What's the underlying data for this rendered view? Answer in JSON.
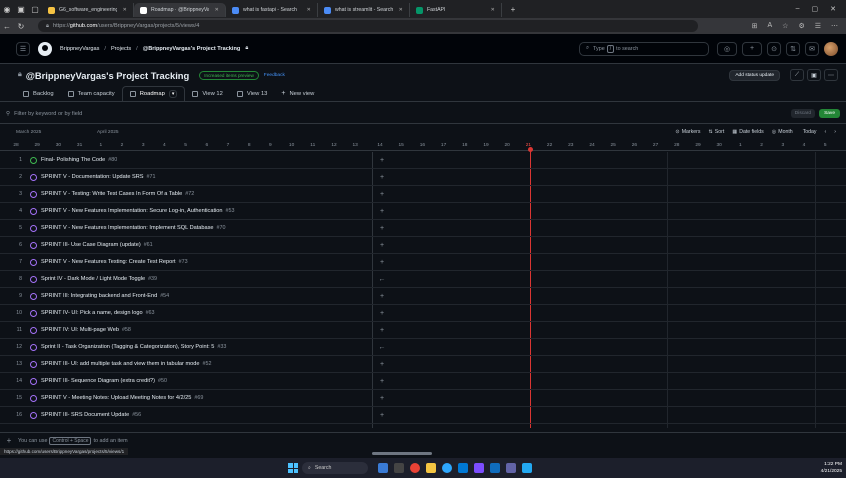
{
  "browser": {
    "tabs": [
      {
        "label": "G6_software_engineering - Goo...",
        "color": "#f6c343"
      },
      {
        "label": "Roadmap · @BrippneyVargas's Pr...",
        "color": "#ffffff",
        "active": true
      },
      {
        "label": "what is fastapi - Search",
        "color": "#4b8bf5"
      },
      {
        "label": "what is streamlit - Search",
        "color": "#4b8bf5"
      },
      {
        "label": "FastAPI",
        "color": "#059669"
      }
    ],
    "url_prefix": "https://",
    "url_host": "github.com",
    "url_path": "/users/BrippneyVargas/projects/5/views/4",
    "status_url": "https://github.com/users/BrippneyVargas/projects/5/views/1"
  },
  "header": {
    "crumb_user": "BrippneyVargas",
    "crumb_sep": "/",
    "crumb_projects": "Projects",
    "crumb_project": "@BrippneyVargas's Project Tracking",
    "search_prefix": "Type",
    "search_key": "/",
    "search_suffix": "to search"
  },
  "project": {
    "title": "@BrippneyVargas's Project Tracking",
    "badge": "Increased items preview",
    "feedback": "Feedback",
    "status_button": "Add status update"
  },
  "views": [
    {
      "label": "Backlog"
    },
    {
      "label": "Team capacity"
    },
    {
      "label": "Roadmap",
      "active": true
    },
    {
      "label": "View 12"
    },
    {
      "label": "View 13"
    },
    {
      "label": "New view"
    }
  ],
  "filter": {
    "placeholder": "Filter by keyword or by field",
    "discard": "Discard",
    "save": "Save"
  },
  "roadmap": {
    "month_left": "March 2025",
    "month_right": "April 2025",
    "tools": [
      "Markers",
      "Sort",
      "Date fields",
      "Month",
      "Today"
    ],
    "days": [
      "28",
      "29",
      "30",
      "31",
      "1",
      "2",
      "3",
      "4",
      "5",
      "6",
      "7",
      "8",
      "9",
      "10",
      "11",
      "12",
      "13",
      "14",
      "15",
      "16",
      "17",
      "18",
      "19",
      "20",
      "21",
      "22",
      "23",
      "24",
      "25",
      "26",
      "27",
      "28",
      "29",
      "30",
      "1",
      "2",
      "3",
      "4",
      "5"
    ],
    "today": "21"
  },
  "items": [
    {
      "num": "1",
      "title": "Final- Polishing The Code",
      "id": "#80",
      "open": true
    },
    {
      "num": "2",
      "title": "SPRINT V - Documentation: Update SRS",
      "id": "#71"
    },
    {
      "num": "3",
      "title": "SPRINT V - Testing: Write Test Cases In Form Of a Table",
      "id": "#72"
    },
    {
      "num": "4",
      "title": "SPRINT V - New Features Implementation: Secure Log-in, Authentication",
      "id": "#53"
    },
    {
      "num": "5",
      "title": "SPRINT V - New Features Implementation: Implement SQL Database",
      "id": "#70"
    },
    {
      "num": "6",
      "title": "SPRINT III- Use Case Diagram (update)",
      "id": "#61"
    },
    {
      "num": "7",
      "title": "SPRINT V - New Features Testing: Create Test Report",
      "id": "#73"
    },
    {
      "num": "8",
      "title": "Sprint IV - Dark Mode / Light Mode Toggle",
      "id": "#39"
    },
    {
      "num": "9",
      "title": "SPRINT III: Integrating backend and Front-End",
      "id": "#54"
    },
    {
      "num": "10",
      "title": "SPRINT IV- UI: Pick a name, design logo",
      "id": "#63"
    },
    {
      "num": "11",
      "title": "SPRINT IV: UI: Multi-page Web",
      "id": "#58"
    },
    {
      "num": "12",
      "title": "Sprint II - Task Organization (Tagging & Categorization), Story Point: 5",
      "id": "#33"
    },
    {
      "num": "13",
      "title": "SPRINT III- UI: add multiple task and view them in tabular mode",
      "id": "#52"
    },
    {
      "num": "14",
      "title": "SPRINT III- Sequence Diagram (extra credit?)",
      "id": "#50"
    },
    {
      "num": "15",
      "title": "SPRINT V - Meeting Notes: Upload Meeting Notes for 4/2/25",
      "id": "#69"
    },
    {
      "num": "16",
      "title": "SPRINT III- SRS Document Update",
      "id": "#56"
    }
  ],
  "footer": {
    "hint_prefix": "You can use",
    "hint_key": "Control + Space",
    "hint_suffix": "to add an item"
  },
  "taskbar": {
    "search": "Search",
    "time": "1:22 PM",
    "date": "4/21/2025"
  }
}
